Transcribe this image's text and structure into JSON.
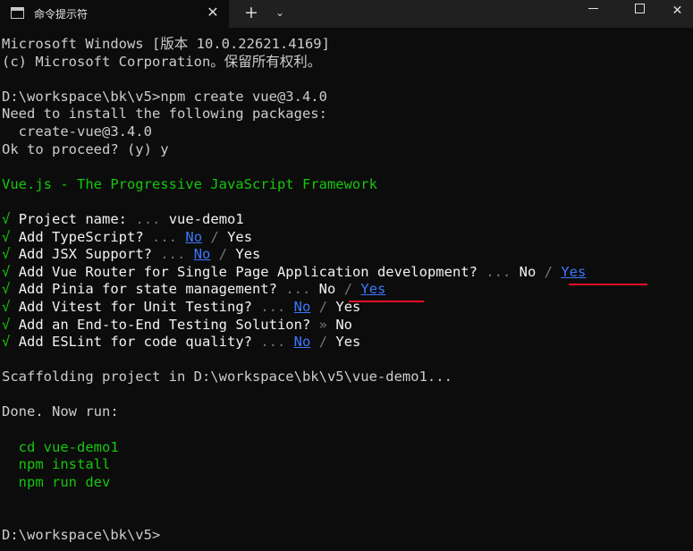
{
  "window": {
    "tab_title": "命令提示符",
    "close_tab": "✕",
    "new_tab": "+",
    "dropdown": "⌄",
    "controls": {
      "minimize": "—",
      "maximize": "☐",
      "close": "✕"
    }
  },
  "terminal": {
    "header": [
      "Microsoft Windows [版本 10.0.22621.4169]",
      "(c) Microsoft Corporation。保留所有权利。"
    ],
    "prompt": "D:\\workspace\\bk\\v5>",
    "command": "npm create vue@3.4.0",
    "install_msg": "Need to install the following packages:",
    "package": "  create-vue@3.4.0",
    "proceed": "Ok to proceed? (y) y",
    "banner": "Vue.js - The Progressive JavaScript Framework",
    "check": "√",
    "ellipsis": "...",
    "arrow": "»",
    "slash": "/",
    "no": "No",
    "yes": "Yes",
    "questions": {
      "project_name": "Project name:",
      "project_name_value": "vue-demo1",
      "typescript": "Add TypeScript?",
      "jsx": "Add JSX Support?",
      "router": "Add Vue Router for Single Page Application development?",
      "pinia": "Add Pinia for state management?",
      "vitest": "Add Vitest for Unit Testing?",
      "e2e": "Add an End-to-End Testing Solution?",
      "eslint": "Add ESLint for code quality?"
    },
    "scaffold": "Scaffolding project in D:\\workspace\\bk\\v5\\vue-demo1...",
    "done": "Done. Now run:",
    "next_steps": [
      "  cd vue-demo1",
      "  npm install",
      "  npm run dev"
    ],
    "final_prompt": "D:\\workspace\\bk\\v5>"
  }
}
